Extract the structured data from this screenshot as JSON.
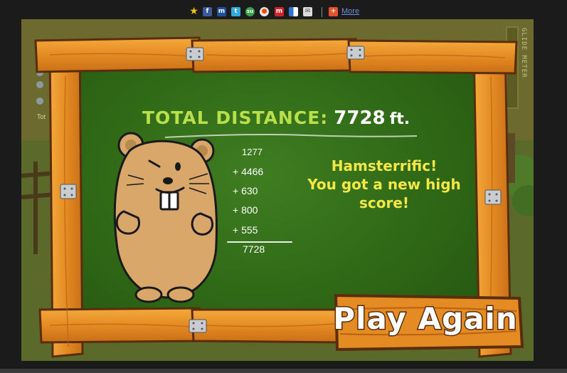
{
  "share_bar": {
    "icons": [
      "favorites-star-icon",
      "facebook-icon",
      "myspace-icon",
      "twitter-icon",
      "stumbleupon-icon",
      "reddit-icon",
      "mixx-icon",
      "delicious-icon",
      "email-icon"
    ],
    "more_label": "More",
    "more_icon": "plus-icon"
  },
  "hud": {
    "glide_meter_label": "GLIDE METER",
    "total_label_fragment": "Tot"
  },
  "results": {
    "total_label": "TOTAL DISTANCE:",
    "total_value": "7728",
    "total_unit": "ft.",
    "distances": [
      "1277",
      "+ 4466",
      "+ 630",
      "+ 800",
      "+ 555"
    ],
    "sum": "7728",
    "message_line1": "Hamsterrific!",
    "message_line2": "You got a new high",
    "message_line3": "score!"
  },
  "play_again_label": "Play Again",
  "colors": {
    "board_green": "#2f6816",
    "wood": "#e9922a",
    "total_label_green": "#b9e04a",
    "message_yellow": "#f4e847",
    "hamster_brown": "#d8a769"
  }
}
